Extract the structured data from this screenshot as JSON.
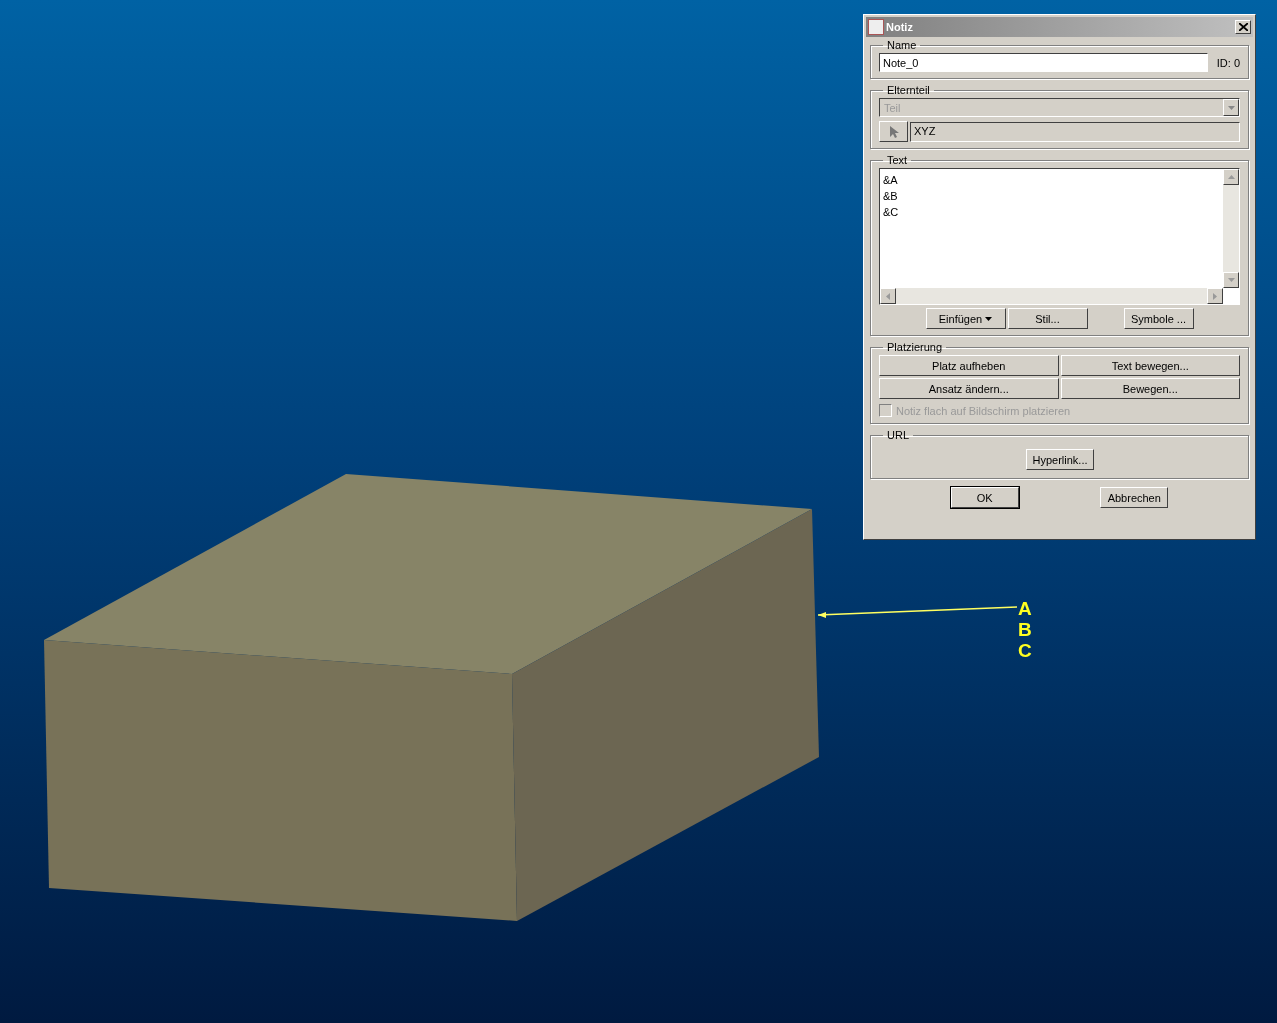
{
  "window": {
    "title": "Notiz"
  },
  "name_group": {
    "label": "Name",
    "value": "Note_0",
    "id_label": "ID: 0"
  },
  "parent_group": {
    "label": "Elternteil",
    "dropdown": {
      "value": "Teil",
      "disabled": true
    },
    "reference": "XYZ"
  },
  "text_group": {
    "label": "Text",
    "lines": [
      "&A",
      "&B",
      "&C"
    ],
    "buttons": [
      {
        "label": "Einfügen",
        "kind": "menu"
      },
      {
        "label": "Stil...",
        "kind": "plain"
      },
      {
        "label": "Symbole ...",
        "kind": "plain"
      }
    ]
  },
  "placement_group": {
    "label": "Platzierung",
    "buttons": [
      "Platz aufheben",
      "Text bewegen...",
      "Ansatz ändern...",
      "Bewegen..."
    ],
    "checkbox": {
      "label": "Notiz flach auf Bildschirm platzieren",
      "checked": false,
      "disabled": true
    }
  },
  "url_group": {
    "label": "URL",
    "button": "Hyperlink..."
  },
  "buttons": [
    {
      "label": "OK",
      "default": true
    },
    {
      "label": "Abbrechen",
      "default": false
    }
  ],
  "annotation": {
    "lines": [
      "A",
      "B",
      "C"
    ]
  }
}
